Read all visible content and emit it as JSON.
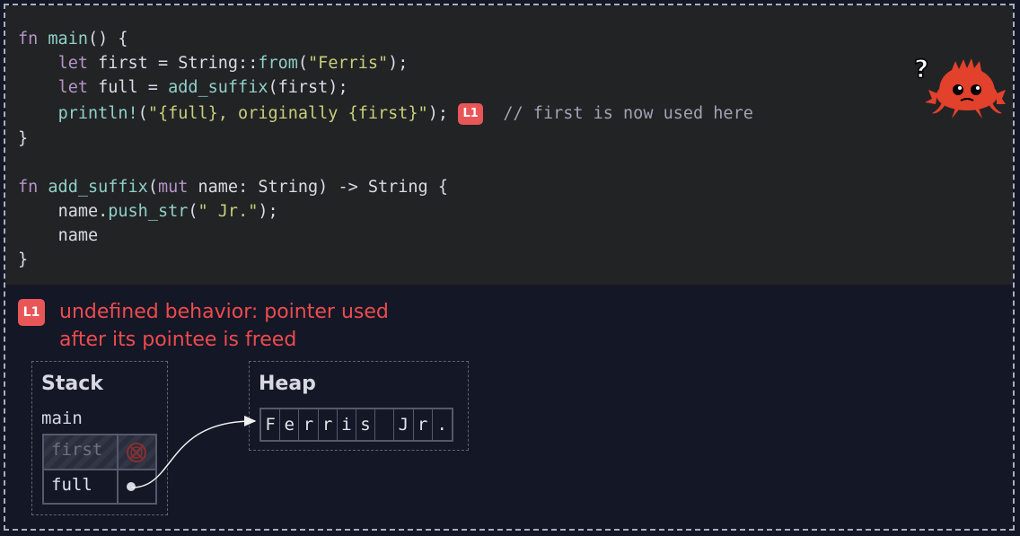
{
  "code": {
    "line1": {
      "kw": "fn",
      "name": "main",
      "rest": "() {"
    },
    "line2": {
      "kw": "let",
      "pre": " first = String::",
      "fn": "from",
      "open": "(",
      "str": "\"Ferris\"",
      "close": ");"
    },
    "line3": {
      "kw": "let",
      "pre": " full = ",
      "fn": "add_suffix",
      "rest": "(first);"
    },
    "line4": {
      "fn": "println!",
      "open": "(",
      "str_a": "\"",
      "interp1": "{full}",
      "str_b": ", originally ",
      "interp2": "{first}",
      "str_c": "\"",
      "close": ");",
      "comment": "// first is now used here"
    },
    "line5": "}",
    "line7": {
      "kw": "fn",
      "name": "add_suffix",
      "open": "(",
      "kw2": "mut",
      "rest": " name: String) -> String {"
    },
    "line8": {
      "pre": "name.",
      "fn": "push_str",
      "open": "(",
      "str": "\" Jr.\"",
      "close": ");"
    },
    "line9": "name",
    "line10": "}"
  },
  "badge": "L1",
  "explanation": "undefined behavior: pointer used after its pointee is freed",
  "stack": {
    "title": "Stack",
    "frame": "main",
    "vars": [
      {
        "name": "first",
        "state": "freed"
      },
      {
        "name": "full",
        "state": "pointer"
      }
    ]
  },
  "heap": {
    "title": "Heap",
    "chars": [
      "F",
      "e",
      "r",
      "r",
      "i",
      "s",
      " ",
      "J",
      "r",
      "."
    ]
  },
  "colors": {
    "code_bg": "#222325",
    "page_bg": "#141726",
    "error": "#ee4b4e",
    "badge": "#e85657",
    "keyword": "#b695c6",
    "function": "#8fd0c9",
    "string": "#c9ce7b",
    "ferris": "#e2412b"
  },
  "icons": [
    "ferris-crab-confused-icon",
    "question-mark-icon",
    "freed-memory-icon",
    "pointer-dot-icon"
  ]
}
